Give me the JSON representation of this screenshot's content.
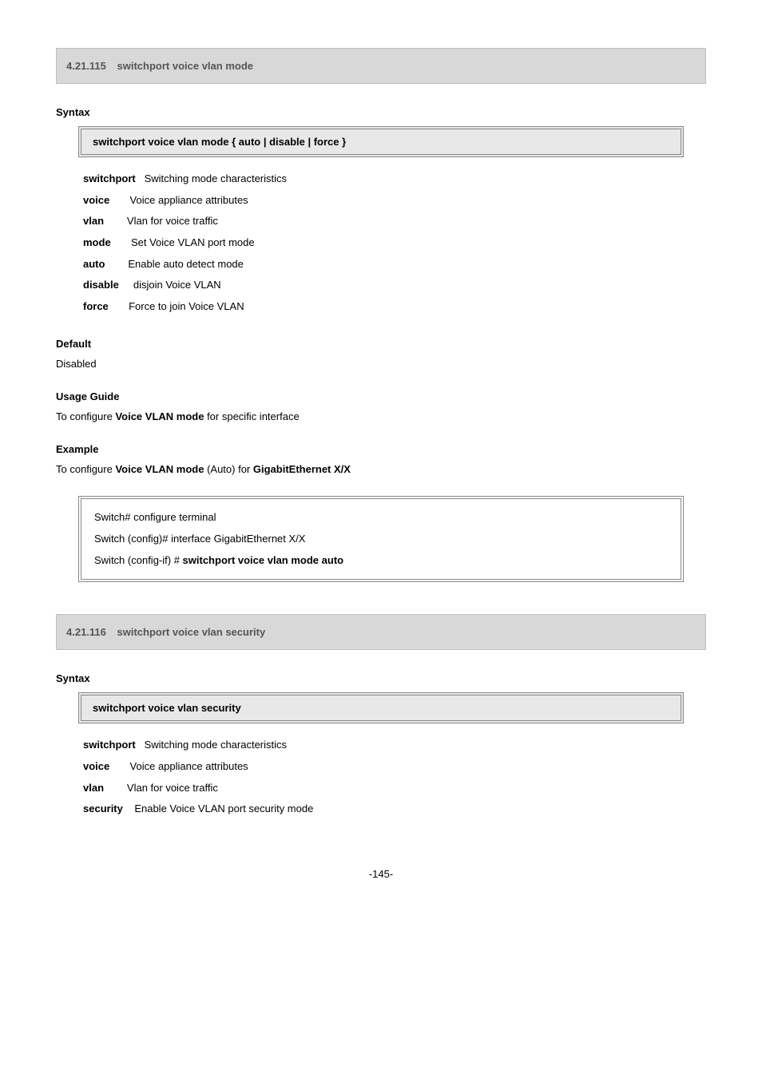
{
  "sections": [
    {
      "number": "4.21.115",
      "title": "switchport voice vlan mode",
      "syntax_label": "Syntax",
      "syntax": "switchport voice vlan mode { auto | disable | force }",
      "params": [
        {
          "kw": "switchport",
          "desc": "   Switching mode characteristics"
        },
        {
          "kw": "voice",
          "desc": "       Voice appliance attributes"
        },
        {
          "kw": "vlan",
          "desc": "        Vlan for voice traffic"
        },
        {
          "kw": "mode",
          "desc": "       Set Voice VLAN port mode"
        },
        {
          "kw": "auto",
          "desc": "        Enable auto detect mode"
        },
        {
          "kw": "disable",
          "desc": "     disjoin Voice VLAN"
        },
        {
          "kw": "force",
          "desc": "       Force to join Voice VLAN"
        }
      ],
      "default_label": "Default",
      "default": "Disabled",
      "usage_label": "Usage Guide",
      "usage_prefix": "To configure ",
      "usage_bold": "Voice VLAN mode",
      "usage_suffix": " for specific interface",
      "example_label": "Example",
      "example_prefix": "To configure ",
      "example_bold": "Voice VLAN mode",
      "example_mid": " (Auto) for ",
      "example_bold2": "GigabitEthernet X/X",
      "example_lines": [
        "Switch# configure terminal",
        "Switch (config)# interface GigabitEthernet X/X",
        "Switch (config-if) # switchport voice vlan mode auto"
      ]
    },
    {
      "number": "4.21.116",
      "title": "switchport voice vlan security",
      "syntax_label": "Syntax",
      "syntax": "switchport voice vlan security",
      "params": [
        {
          "kw": "switchport",
          "desc": "   Switching mode characteristics"
        },
        {
          "kw": "voice",
          "desc": "       Voice appliance attributes"
        },
        {
          "kw": "vlan",
          "desc": "        Vlan for voice traffic"
        },
        {
          "kw": "security",
          "desc": "    Enable Voice VLAN port security mode"
        }
      ]
    }
  ],
  "page_number": "-145-"
}
